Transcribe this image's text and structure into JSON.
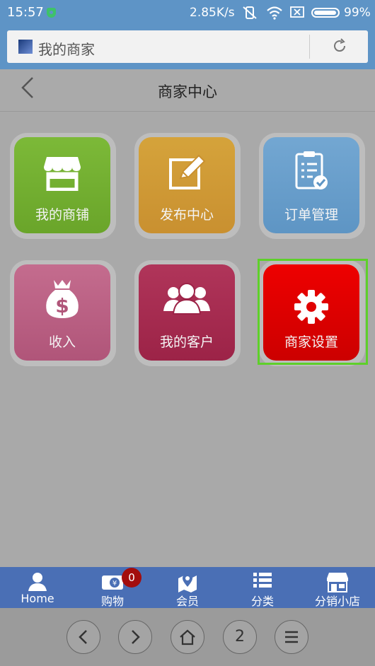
{
  "status_bar": {
    "time": "15:57",
    "speed": "2.85K/s",
    "battery": "99%"
  },
  "browser": {
    "url_title": "我的商家"
  },
  "header": {
    "title": "商家中心"
  },
  "tiles": [
    {
      "label": "我的商铺",
      "icon": "shop-icon",
      "color": "#7cb938"
    },
    {
      "label": "发布中心",
      "icon": "edit-icon",
      "color": "#d5a33b"
    },
    {
      "label": "订单管理",
      "icon": "clipboard-icon",
      "color": "#73a7d2"
    },
    {
      "label": "收入",
      "icon": "money-bag-icon",
      "color": "#c46c8e"
    },
    {
      "label": "我的客户",
      "icon": "customers-icon",
      "color": "#b0355a"
    },
    {
      "label": "商家设置",
      "icon": "gear-icon",
      "color": "#ee0000"
    }
  ],
  "tabbar": {
    "items": [
      {
        "label": "Home",
        "icon": "person-icon"
      },
      {
        "label": "购物",
        "icon": "wallet-icon"
      },
      {
        "label": "会员",
        "icon": "map-pin-icon"
      },
      {
        "label": "分类",
        "icon": "list-icon"
      },
      {
        "label": "分销小店",
        "icon": "store-icon"
      }
    ],
    "cart_badge": "0"
  },
  "browser_nav": {
    "tab_count": "2"
  }
}
